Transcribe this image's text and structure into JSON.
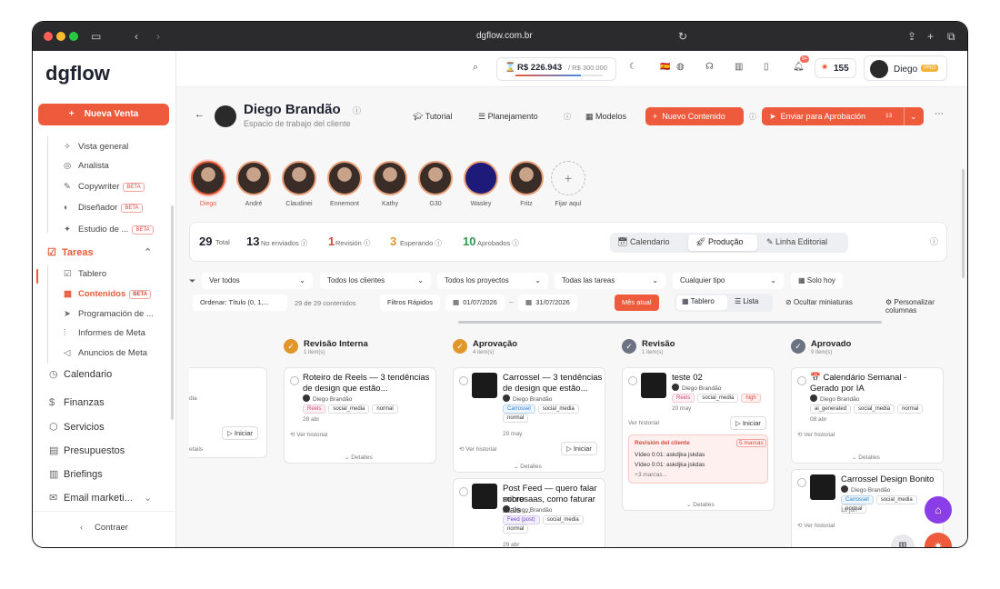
{
  "browser": {
    "url": "dgflow.com.br"
  },
  "sidebar": {
    "logo": "dgflow",
    "new_sale": "Nueva Venta",
    "items": [
      {
        "label": "Vista general",
        "icon": "sparkle-icon",
        "beta": ""
      },
      {
        "label": "Analista",
        "icon": "globe-icon",
        "beta": ""
      },
      {
        "label": "Copywriter",
        "icon": "pen-icon",
        "beta": "BETA"
      },
      {
        "label": "Diseñador",
        "icon": "palette-icon",
        "beta": "BETA"
      },
      {
        "label": "Estudio de ...",
        "icon": "sparkles-icon",
        "beta": "BETA"
      }
    ],
    "tareas": "Tareas",
    "sub": [
      {
        "label": "Tablero"
      },
      {
        "label": "Contenidos",
        "beta": "BETA"
      },
      {
        "label": "Programación de ..."
      },
      {
        "label": "Informes de Meta"
      },
      {
        "label": "Anuncios de Meta"
      }
    ],
    "main": [
      {
        "label": "Calendario"
      },
      {
        "label": "Finanzas"
      },
      {
        "label": "Servicios"
      },
      {
        "label": "Presupuestos"
      },
      {
        "label": "Briefings"
      },
      {
        "label": "Email marketi..."
      }
    ],
    "collapse": "Contraer"
  },
  "topbar": {
    "balance": "R$ 226.943",
    "limit": "/ R$ 300.000",
    "notif_badge": "9+",
    "credits": "155",
    "user": "Diego",
    "pro": "PRO"
  },
  "header": {
    "name": "Diego Brandão",
    "subtitle": "Espacio de trabajo del cliente",
    "tutorial": "Tutorial",
    "planejamento": "Planejamento",
    "modelos": "Modelos",
    "nuevo": "Nuevo Contenido",
    "enviar": "Enviar para Aprobación",
    "enviar_count": "13"
  },
  "avatars": [
    "Diego",
    "André",
    "Claudinei",
    "Ennemont",
    "Kathy",
    "G30",
    "Wasley",
    "Fritz"
  ],
  "pin": "Fijar aquí",
  "stats": [
    {
      "n": "29",
      "l": "Total"
    },
    {
      "n": "13",
      "l": "No enviados"
    },
    {
      "n": "1",
      "l": "Revisión"
    },
    {
      "n": "3",
      "l": "Esperando"
    },
    {
      "n": "10",
      "l": "Aprobados"
    }
  ],
  "views": {
    "cal": "Calendario",
    "prod": "Produção",
    "linha": "Linha Editorial"
  },
  "filters": {
    "ver": "Ver todos",
    "clientes": "Todos los clientes",
    "proyectos": "Todos los proyectos",
    "tareas": "Todas las tareas",
    "tipo": "Cualquier tipo",
    "hoy": "Solo hoy"
  },
  "row2": {
    "ordenar": "Ordenar: Título (0, 1,...",
    "count": "29 de 29 contenidos",
    "rapidos": "Filtros Rápidos",
    "d1": "01/07/2026",
    "d2": "31/07/2026",
    "mes": "Mês atual",
    "tablero": "Tablero",
    "lista": "Lista",
    "ocultar": "Ocultar miniaturas",
    "personalizar": "Personalizar columnas"
  },
  "common": {
    "author": "Diego Brandão",
    "ver_historial": "Ver historial",
    "detalles": "Detalles",
    "iniciar": "Iniciar",
    "social": "social_media",
    "normal": "normal"
  },
  "columns": [
    {
      "title": "Revisão Interna",
      "sub": "1 item(s)",
      "cards": [
        {
          "title1": "Roteiro de Reels — 3 tendências",
          "title2": "de design que estão...",
          "tag": "Reels",
          "date": "28 abr"
        }
      ]
    },
    {
      "title": "Aprovação",
      "sub": "4 item(s)",
      "cards": [
        {
          "title1": "Carrossel — 3 tendências",
          "title2": "de design que estão...",
          "tag": "Carrossel",
          "date": "20 may"
        },
        {
          "title1": "Post Feed — quero falar sobre",
          "title2": "microsaas, como faturar mais ...",
          "tag": "Feed (post)",
          "date": "29 abr"
        }
      ]
    },
    {
      "title": "Revisão",
      "sub": "1 item(s)",
      "cards": [
        {
          "title1": "teste 02",
          "tag": "Reels",
          "prio": "high",
          "date": "20 may",
          "rev_title": "Revisión del cliente",
          "rev_marks": "5 marcas",
          "rev1": "Vídeo 0:01: askdjka jskdas",
          "rev2": "Vídeo 0:01: askdjka jskdas",
          "rev_more": "+3 marcas..."
        }
      ]
    },
    {
      "title": "Aprovado",
      "sub": "9 item(s)",
      "cards": [
        {
          "title1": "📅 Calendário Semanal -",
          "title2": "Gerado por IA",
          "tag": "ai_generated",
          "date": "08 abr"
        },
        {
          "title1": "Carrossel Design Bonito",
          "tag": "Carrossel",
          "date": "18 jun"
        }
      ]
    }
  ],
  "left_partial": {
    "detail": "Detalles"
  }
}
